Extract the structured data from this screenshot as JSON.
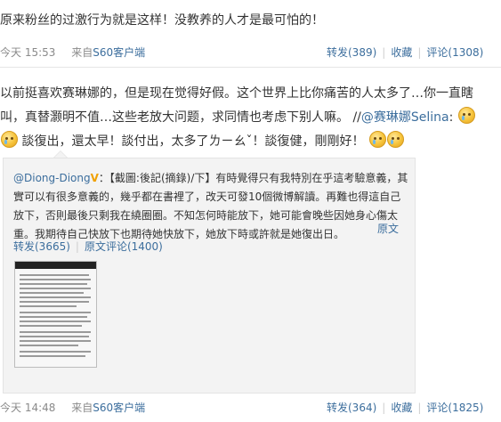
{
  "post1": {
    "text": "原来粉丝的过激行为就是这样！没教养的人才是最可怕的！",
    "time": "今天 15:53",
    "source_prefix": "来自",
    "source": "S60客户端",
    "forward": "转发(389)",
    "favorite": "收藏",
    "comment": "评论(1308)"
  },
  "post2": {
    "text_a": "以前挺喜欢赛琳娜的，但是现在觉得好假。这个世界上比你痛苦的人太多了…你一直瞎叫，真替灏明不值…这些老放大问题，求同情也考虑下别人嘛。 //",
    "mention": "@赛琳娜Selina",
    "text_b": ":",
    "text_c": "談復出，還太早！談付出，太多了ㄌㄧㄠˇ！談復健，剛剛好！",
    "repost": {
      "author": "@Diong-Diong",
      "badge": "V",
      "text": "：【截圖:後記(摘錄)/下】有時覺得只有我特別在乎這考驗意義，其實可以有很多意義的，幾乎都在書裡了，改天可發10個微博解讀。再難也得這自己放下，否則最後只剩我在繞圈圈。不知怎何時能放下，她可能會晚些因她身心傷太重。我期待自己快放下也期待她快放下，她放下時或許就是她復出日。",
      "orig_label": "原文",
      "forward": "转发(3665)",
      "orig_comment": "原文评论(1400)"
    },
    "time": "今天 14:48",
    "source_prefix": "来自",
    "source": "S60客户端",
    "forward": "转发(364)",
    "favorite": "收藏",
    "comment": "评论(1825)"
  },
  "colors": {
    "link": "#3c6e9d",
    "meta_gray": "#8a8a8a",
    "repost_bg": "#f3f3f3",
    "vip_badge": "#f0a000"
  },
  "icons": {
    "emoji": "crying-face-icon"
  }
}
